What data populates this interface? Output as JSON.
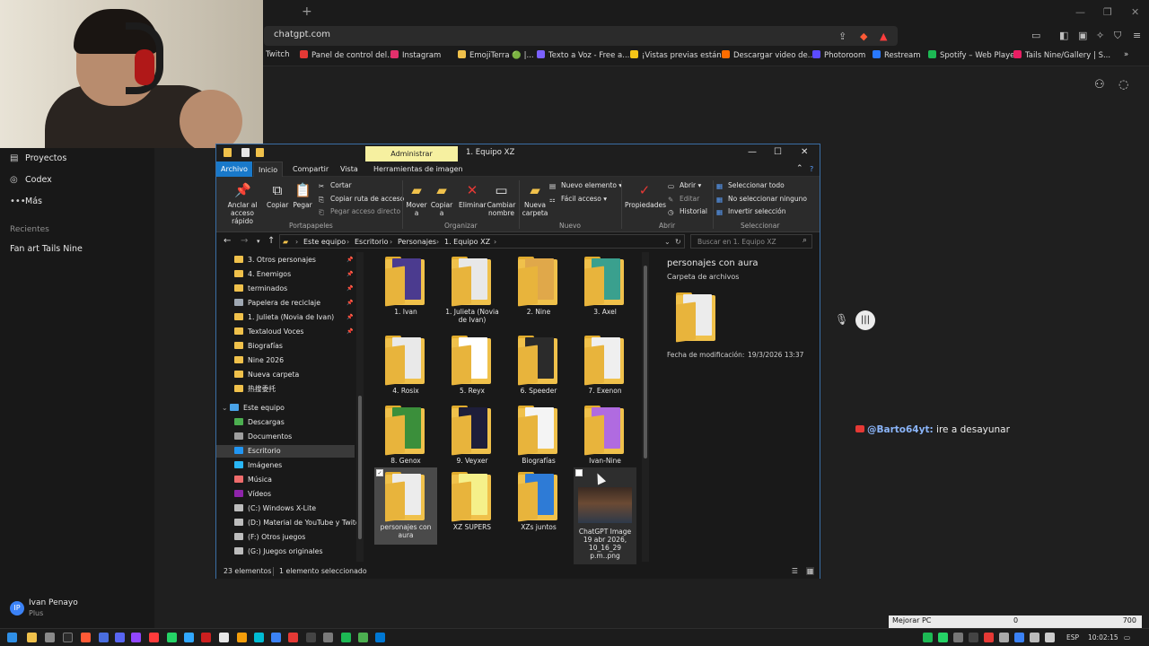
{
  "browser": {
    "url": "chatgpt.com",
    "bookmarks": [
      {
        "label": "Twitch",
        "color": "#9146ff"
      },
      {
        "label": "Panel de control del...",
        "color": "#e53935"
      },
      {
        "label": "Instagram",
        "color": "#e1306c"
      },
      {
        "label": "EmojiTerra 🟢 |...",
        "color": "#f0c14b"
      },
      {
        "label": "Texto a Voz - Free a...",
        "color": "#7b61ff"
      },
      {
        "label": "¡Vistas previas están...",
        "color": "#f5c518"
      },
      {
        "label": "Descargar video de...",
        "color": "#ff6d00"
      },
      {
        "label": "Photoroom",
        "color": "#5b4bff"
      },
      {
        "label": "Restream",
        "color": "#2979ff"
      },
      {
        "label": "Spotify – Web Player",
        "color": "#1db954"
      },
      {
        "label": "Tails Nine/Gallery | S...",
        "color": "#e91e63"
      }
    ],
    "more": "»"
  },
  "sidebar": {
    "items": [
      {
        "icon": "▤",
        "label": "Proyectos"
      },
      {
        "icon": "◎",
        "label": "Codex"
      },
      {
        "icon": "•••",
        "label": "Más"
      }
    ],
    "recent_title": "Recientes",
    "recent": [
      "Fan art Tails Nine"
    ],
    "user": {
      "initial": "IP",
      "name": "Ivan Penayo",
      "plan": "Plus"
    }
  },
  "chat": {
    "user": "@Barto64yt:",
    "message": "ire a desayunar"
  },
  "explorer": {
    "title": "1. Equipo XZ",
    "admin_label": "Administrar",
    "ribbon_tabs": [
      "Archivo",
      "Inicio",
      "Compartir",
      "Vista",
      "Herramientas de imagen"
    ],
    "ribbon": {
      "pin": "Anclar al acceso rápido",
      "copy": "Copiar",
      "paste": "Pegar",
      "cut": "Cortar",
      "copy_path": "Copiar ruta de acceso",
      "paste_shortcut": "Pegar acceso directo",
      "group_clipboard": "Portapapeles",
      "move_to": "Mover a",
      "copy_to": "Copiar a",
      "delete": "Eliminar",
      "rename": "Cambiar nombre",
      "group_organize": "Organizar",
      "new_folder": "Nueva carpeta",
      "new_item": "Nuevo elemento",
      "easy_access": "Fácil acceso",
      "group_new": "Nuevo",
      "properties": "Propiedades",
      "open": "Abrir",
      "edit": "Editar",
      "history": "Historial",
      "group_open": "Abrir",
      "select_all": "Seleccionar todo",
      "select_none": "No seleccionar ninguno",
      "invert": "Invertir selección",
      "group_select": "Seleccionar"
    },
    "breadcrumb": [
      "Este equipo",
      "Escritorio",
      "Personajes",
      "1. Equipo XZ"
    ],
    "search_placeholder": "Buscar en 1. Equipo XZ",
    "nav_items": [
      {
        "label": "3. Otros personajes",
        "pinned": true,
        "type": "folder"
      },
      {
        "label": "4. Enemigos",
        "pinned": true,
        "type": "folder"
      },
      {
        "label": "terminados",
        "pinned": true,
        "type": "folder"
      },
      {
        "label": "Papelera de reciclaje",
        "pinned": true,
        "type": "bin"
      },
      {
        "label": "1. Julieta (Novia de Ivan)",
        "pinned": true,
        "type": "folder"
      },
      {
        "label": "Textaloud Voces",
        "pinned": true,
        "type": "folder"
      },
      {
        "label": "Biografías",
        "pinned": false,
        "type": "folder"
      },
      {
        "label": "Nine 2026",
        "pinned": false,
        "type": "folder"
      },
      {
        "label": "Nueva carpeta",
        "pinned": false,
        "type": "folder"
      },
      {
        "label": "热搜委托",
        "pinned": false,
        "type": "folder"
      }
    ],
    "this_pc": "Este equipo",
    "pc_items": [
      {
        "label": "Descargas",
        "color": "#4caf50"
      },
      {
        "label": "Documentos",
        "color": "#9e9e9e"
      },
      {
        "label": "Escritorio",
        "color": "#2196f3",
        "selected": true
      },
      {
        "label": "Imágenes",
        "color": "#29b6f6"
      },
      {
        "label": "Música",
        "color": "#ef6c6c"
      },
      {
        "label": "Vídeos",
        "color": "#8e24aa"
      },
      {
        "label": "(C:) Windows X-Lite",
        "color": "#bdbdbd"
      },
      {
        "label": "(D:) Material de YouTube y Twitch",
        "color": "#bdbdbd"
      },
      {
        "label": "(F:) Otros juegos",
        "color": "#bdbdbd"
      },
      {
        "label": "(G:) Juegos originales",
        "color": "#bdbdbd"
      }
    ],
    "files": [
      {
        "label": "1. Ivan",
        "art": "#4b3b8f"
      },
      {
        "label": "1. Julieta (Novia de Ivan)",
        "art": "#e8e8e8"
      },
      {
        "label": "2. Nine",
        "art": "#e0a84a"
      },
      {
        "label": "3. Axel",
        "art": "#3aa08e"
      },
      {
        "label": "4. Rosix",
        "art": "#e9e9e9"
      },
      {
        "label": "5. Reyx",
        "art": "#ffffff"
      },
      {
        "label": "6. Speeder",
        "art": "#2b2b2b"
      },
      {
        "label": "7. Exenon",
        "art": "#efefef"
      },
      {
        "label": "8. Genox",
        "art": "#3b8f3b"
      },
      {
        "label": "9. Veyxer",
        "art": "#1e1e3a"
      },
      {
        "label": "Biografías",
        "art": "#f4f4f4"
      },
      {
        "label": "Ivan-Nine",
        "art": "#b06be0"
      },
      {
        "label": "personajes con aura",
        "art": "#ececec",
        "selected": true
      },
      {
        "label": "XZ SUPERS",
        "art": "#f5f08a"
      },
      {
        "label": "XZs juntos",
        "art": "#2e7bd6"
      },
      {
        "label": "ChatGPT Image 19 abr 2026, 10_16_29 p.m..png",
        "image": true
      }
    ],
    "preview": {
      "name": "personajes con aura",
      "kind": "Carpeta de archivos",
      "modified_label": "Fecha de modificación:",
      "modified_value": "19/3/2026 13:37"
    },
    "status": {
      "count": "23 elementos",
      "selection": "1 elemento seleccionado"
    }
  },
  "taskbar": {
    "lang": "ESP",
    "time": "10:02:15",
    "perf_label": "Mejorar PC",
    "perf_zero": "0",
    "perf_value": "700"
  }
}
